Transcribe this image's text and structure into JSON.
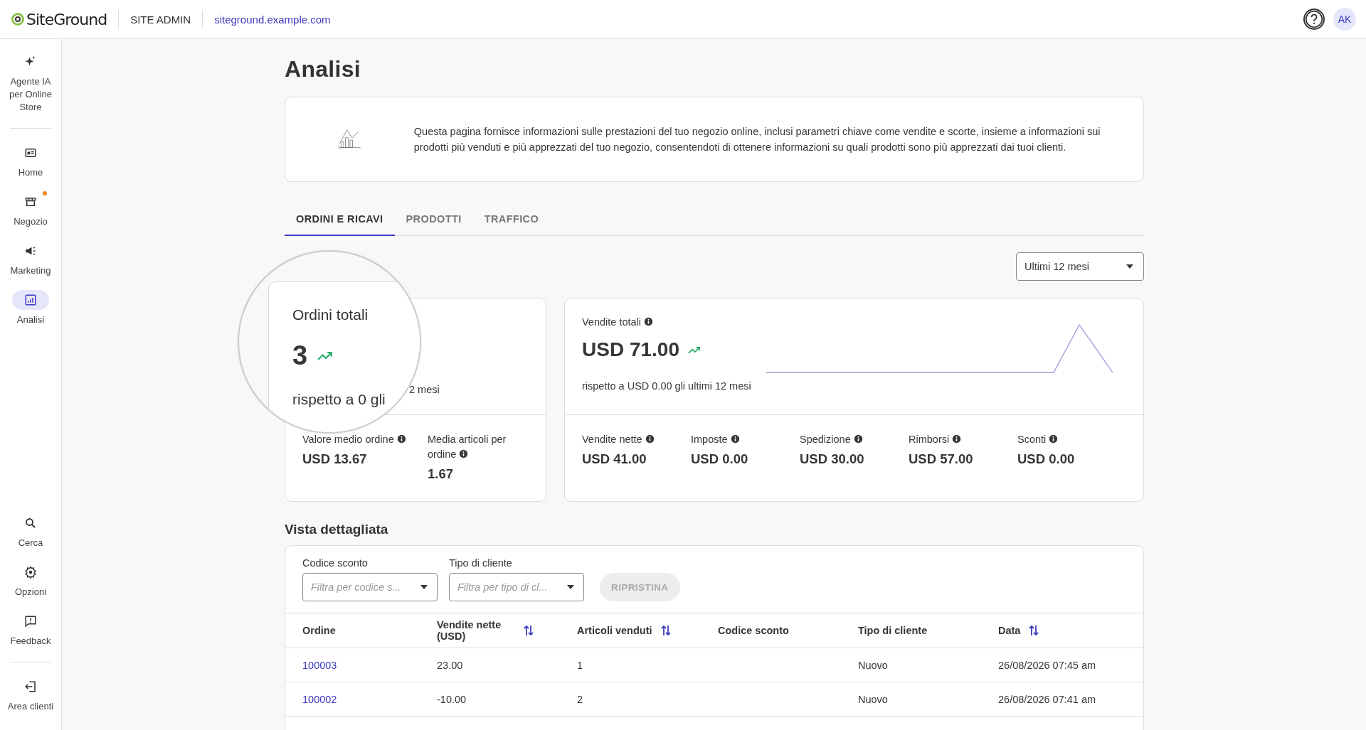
{
  "header": {
    "logo": "SiteGround",
    "section": "SITE ADMIN",
    "site": "siteground.example.com",
    "avatar": "AK"
  },
  "sidebar": {
    "top": [
      {
        "label": "Agente IA per Online Store",
        "selected": false,
        "badge": false
      }
    ],
    "items": [
      {
        "label": "Home",
        "selected": false,
        "badge": false
      },
      {
        "label": "Negozio",
        "selected": false,
        "badge": true
      },
      {
        "label": "Marketing",
        "selected": false,
        "badge": false
      },
      {
        "label": "Analisi",
        "selected": true,
        "badge": false
      }
    ],
    "bottom": [
      {
        "label": "Cerca",
        "selected": false,
        "badge": false
      },
      {
        "label": "Opzioni",
        "selected": false,
        "badge": false
      },
      {
        "label": "Feedback",
        "selected": false,
        "badge": false
      }
    ],
    "footer": [
      {
        "label": "Area clienti",
        "selected": false,
        "badge": false
      }
    ]
  },
  "page": {
    "title": "Analisi",
    "intro": "Questa pagina fornisce informazioni sulle prestazioni del tuo negozio online, inclusi parametri chiave come vendite e scorte, insieme a informazioni sui prodotti più venduti e più apprezzati del tuo negozio, consentendoti di ottenere informazioni su quali prodotti sono più apprezzati dai tuoi clienti."
  },
  "tabs": [
    {
      "label": "ORDINI E RICAVI",
      "selected": true
    },
    {
      "label": "PRODOTTI",
      "selected": false
    },
    {
      "label": "TRAFFICO",
      "selected": false
    }
  ],
  "period": {
    "value": "Ultimi 12 mesi"
  },
  "orders_card": {
    "lens": {
      "label": "Ordini totali",
      "value": "3",
      "comparison": "rispetto a 0 gli"
    },
    "comparison_visible": "2 mesi",
    "metrics": [
      {
        "label": "Valore medio ordine",
        "value": "USD 13.67"
      },
      {
        "label": "Media articoli per ordine",
        "value": "1.67"
      }
    ]
  },
  "sales_card": {
    "label": "Vendite totali",
    "value": "USD 71.00",
    "comparison": "rispetto a USD 0.00 gli ultimi 12 mesi",
    "metrics": [
      {
        "label": "Vendite nette",
        "value": "USD 41.00"
      },
      {
        "label": "Imposte",
        "value": "USD 0.00"
      },
      {
        "label": "Spedizione",
        "value": "USD 30.00"
      },
      {
        "label": "Rimborsi",
        "value": "USD 57.00"
      },
      {
        "label": "Sconti",
        "value": "USD 0.00"
      }
    ]
  },
  "detail": {
    "title": "Vista dettagliata",
    "filters": [
      {
        "label": "Codice sconto",
        "placeholder": "Filtra per codice s..."
      },
      {
        "label": "Tipo di cliente",
        "placeholder": "Filtra per tipo di cl..."
      }
    ],
    "reset": {
      "label": "RIPRISTINA",
      "disabled": true
    },
    "columns": [
      {
        "label": "Ordine",
        "sortable": false
      },
      {
        "label": "Vendite nette (USD)",
        "sortable": true
      },
      {
        "label": "Articoli venduti",
        "sortable": true
      },
      {
        "label": "Codice sconto",
        "sortable": false
      },
      {
        "label": "Tipo di cliente",
        "sortable": false
      },
      {
        "label": "Data",
        "sortable": true
      }
    ],
    "rows": [
      [
        "100003",
        "23.00",
        "1",
        "",
        "Nuovo",
        "26/08/2026 07:45 am"
      ],
      [
        "100002",
        "-10.00",
        "2",
        "",
        "Nuovo",
        "26/08/2026 07:41 am"
      ]
    ]
  }
}
